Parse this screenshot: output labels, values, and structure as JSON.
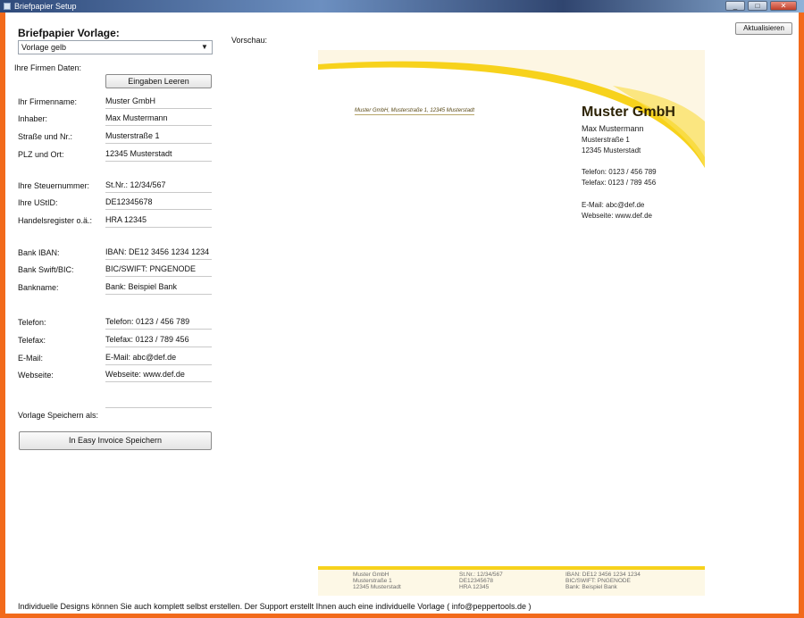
{
  "window": {
    "title": "Briefpapier Setup",
    "controls": [
      "_",
      "□",
      "✕"
    ]
  },
  "left": {
    "heading": "Briefpapier Vorlage:",
    "template_select": "Vorlage gelb",
    "company_data_label": "Ihre Firmen Daten:",
    "clear_button": "Eingaben Leeren",
    "fields": [
      {
        "label": "Ihr Firmenname:",
        "value": "Muster GmbH"
      },
      {
        "label": "Inhaber:",
        "value": "Max Mustermann"
      },
      {
        "label": "Straße und Nr.:",
        "value": "Musterstraße 1"
      },
      {
        "label": "PLZ und Ort:",
        "value": "12345 Musterstadt"
      },
      {
        "label": "Ihre Steuernummer:",
        "value": "St.Nr.: 12/34/567"
      },
      {
        "label": "Ihre UStID:",
        "value": "DE12345678"
      },
      {
        "label": "Handelsregister o.ä.:",
        "value": "HRA 12345"
      },
      {
        "label": "Bank IBAN:",
        "value": "IBAN: DE12 3456 1234 1234"
      },
      {
        "label": "Bank Swift/BIC:",
        "value": "BIC/SWIFT: PNGENODE"
      },
      {
        "label": "Bankname:",
        "value": "Bank: Beispiel Bank"
      },
      {
        "label": "Telefon:",
        "value": "Telefon: 0123 / 456 789"
      },
      {
        "label": "Telefax:",
        "value": "Telefax: 0123 / 789 456"
      },
      {
        "label": "E-Mail:",
        "value": "E-Mail: abc@def.de"
      },
      {
        "label": "Webseite:",
        "value": "Webseite: www.def.de"
      }
    ],
    "save_as_label": "Vorlage Speichern als:",
    "save_as_value": "",
    "save_button": "In Easy Invoice Speichern"
  },
  "preview": {
    "label": "Vorschau:",
    "refresh_button": "Aktualisieren",
    "sender_line": "Muster GmbH, Musterstraße 1, 12345 Musterstadt",
    "company": "Muster GmbH",
    "owner": "Max Mustermann",
    "street": "Musterstraße 1",
    "city": "12345 Musterstadt",
    "phone": "Telefon: 0123 / 456 789",
    "fax": "Telefax: 0123 / 789 456",
    "email": "E-Mail: abc@def.de",
    "website": "Webseite: www.def.de",
    "footer": {
      "col1": [
        "Muster GmbH",
        "Musterstraße 1",
        "12345 Musterstadt"
      ],
      "col2": [
        "St.Nr.: 12/34/567",
        "DE12345678",
        "HRA 12345"
      ],
      "col3": [
        "IBAN: DE12 3456 1234 1234",
        "BIC/SWIFT: PNGENODE",
        "Bank: Beispiel Bank"
      ]
    },
    "accent_color": "#f7d21c",
    "background_tint": "#fdf6e3"
  },
  "bottom_note": "Individuelle Designs können Sie auch komplett selbst erstellen. Der Support erstellt Ihnen auch eine individuelle Vorlage ( info@peppertools.de )"
}
